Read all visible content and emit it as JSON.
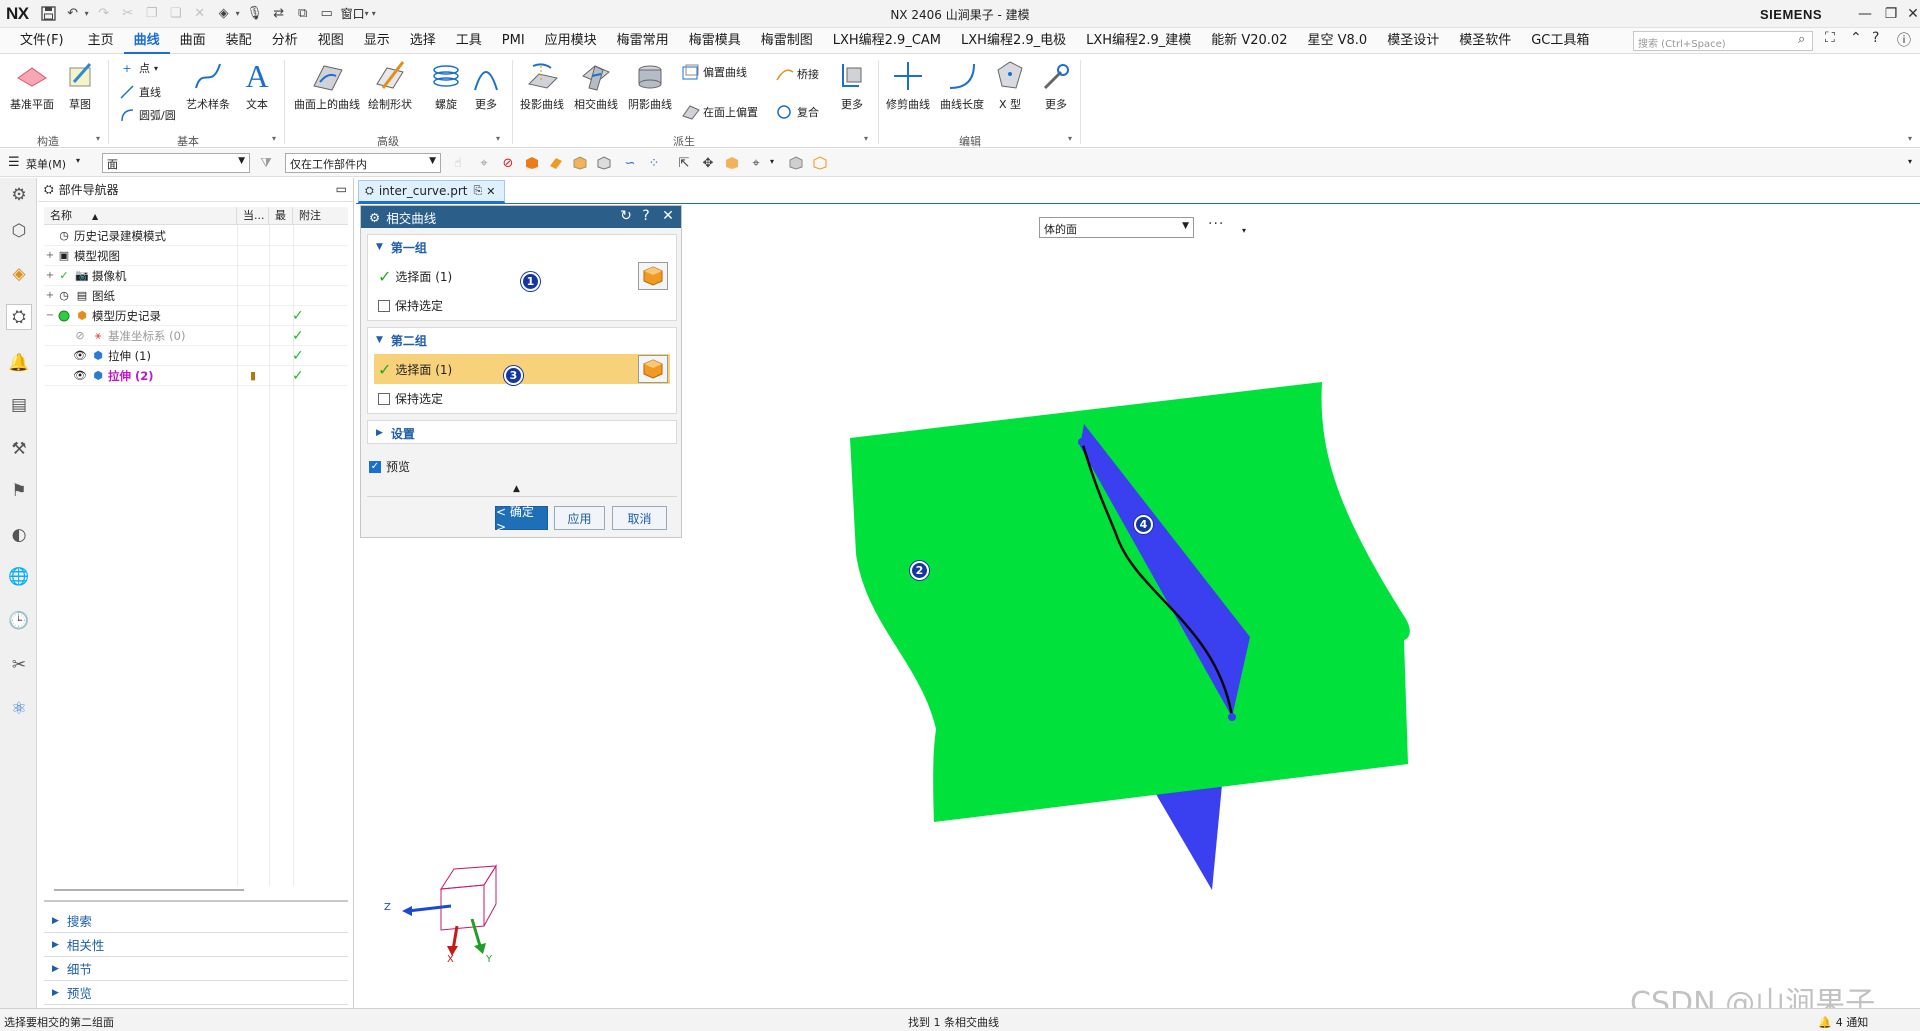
{
  "window": {
    "app_logo": "NX",
    "title": "NX 2406 山涧果子 - 建模",
    "brand": "SIEMENS",
    "window_menu": "窗口"
  },
  "menu": {
    "file": "文件(F)",
    "tabs": [
      "主页",
      "曲线",
      "曲面",
      "装配",
      "分析",
      "视图",
      "显示",
      "选择",
      "工具",
      "PMI",
      "应用模块",
      "梅雷常用",
      "梅雷模具",
      "梅雷制图",
      "LXH编程2.9_CAM",
      "LXH编程2.9_电极",
      "LXH编程2.9_建模",
      "能新 V20.02",
      "星空 V8.0",
      "模圣设计",
      "模圣软件",
      "GC工具箱"
    ],
    "active_tab": "曲线",
    "search_placeholder": "搜索 (Ctrl+Space)"
  },
  "ribbon": {
    "groups": {
      "construct": "构造",
      "basic": "基本",
      "advanced": "高级",
      "derived": "派生",
      "edit": "编辑"
    },
    "buttons": {
      "datum_plane": "基准平面",
      "sketch": "草图",
      "point": "点",
      "line": "直线",
      "arc_circle": "圆弧/圆",
      "art_spline": "艺术样条",
      "text": "文本",
      "curve_on_surface": "曲面上的曲线",
      "draw_shape": "绘制形状",
      "helix": "螺旋",
      "more": "更多",
      "project_curve": "投影曲线",
      "intersect_curve": "相交曲线",
      "shadow_curve": "阴影曲线",
      "offset_curve": "偏置曲线",
      "bridge": "桥接",
      "offset_on_face": "在面上偏置",
      "composite": "复合",
      "trim_curve": "修剪曲线",
      "curve_length": "曲线长度",
      "x_type": "X 型"
    }
  },
  "selbar": {
    "menu": "菜单(M)",
    "type_filter": "面",
    "scope": "仅在工作部件内"
  },
  "navigator": {
    "title": "部件导航器",
    "columns": [
      "名称",
      "当...",
      "最",
      "附注"
    ],
    "rows": [
      {
        "label": "历史记录建模模式",
        "icon": "clock-icon"
      },
      {
        "label": "模型视图",
        "icon": "model-view-icon"
      },
      {
        "label": "摄像机",
        "icon": "camera-icon"
      },
      {
        "label": "图纸",
        "icon": "drawing-icon"
      },
      {
        "label": "模型历史记录",
        "icon": "history-icon"
      },
      {
        "label": "基准坐标系 (0)",
        "icon": "csys-icon"
      },
      {
        "label": "拉伸 (1)",
        "icon": "extrude-icon"
      },
      {
        "label": "拉伸 (2)",
        "icon": "extrude-icon"
      }
    ],
    "sections": [
      "搜索",
      "相关性",
      "细节",
      "预览"
    ]
  },
  "doc_tab": {
    "label": "inter_curve.prt"
  },
  "dialog": {
    "title": "相交曲线",
    "group1": {
      "title": "第一组",
      "select_label": "选择面 (1)",
      "keep_label": "保持选定"
    },
    "group2": {
      "title": "第二组",
      "select_label": "选择面 (1)",
      "keep_label": "保持选定"
    },
    "settings": "设置",
    "preview": "预览",
    "ok": "< 确定 >",
    "apply": "应用",
    "cancel": "取消",
    "badges": [
      "1",
      "3"
    ]
  },
  "graphics": {
    "filter": "体的面",
    "badges": [
      "2",
      "4"
    ],
    "axes": {
      "z": "Z",
      "x": "X",
      "y": "Y"
    },
    "colors": {
      "sheet": "#00e13c",
      "plane": "#3a3ff0",
      "curve": "#0a0a0a"
    }
  },
  "status": {
    "left": "选择要相交的第二组面",
    "middle": "找到 1 条相交曲线",
    "right": "4 通知"
  },
  "watermark": "CSDN @山涧果子"
}
